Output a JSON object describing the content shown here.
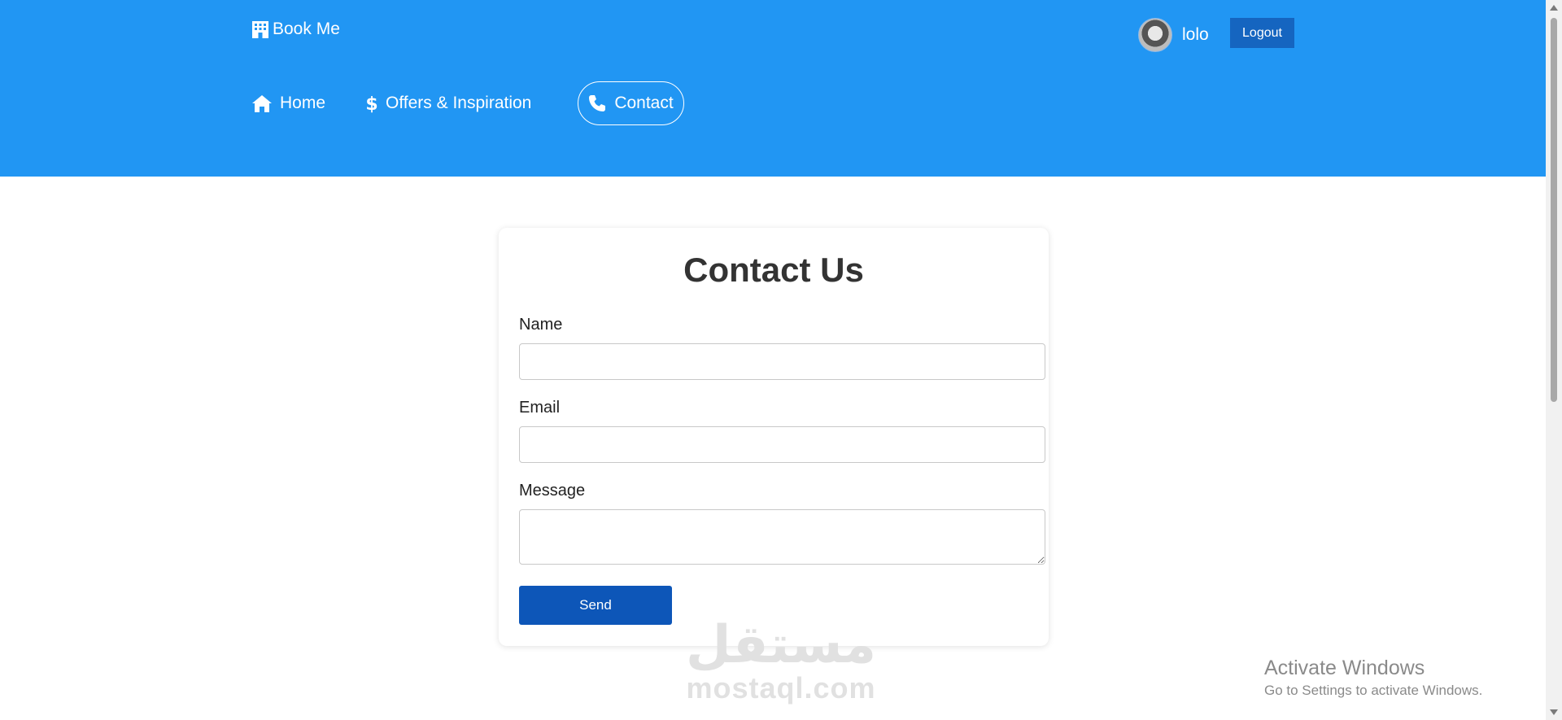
{
  "header": {
    "brand": "Book Me",
    "user": {
      "name": "lolo",
      "avatar_icon": "user-avatar"
    },
    "logout_label": "Logout",
    "background_color": "#2196f3"
  },
  "nav": {
    "items": [
      {
        "label": "Home",
        "icon": "home-icon"
      },
      {
        "label": "Offers & Inspiration",
        "icon": "dollar-icon"
      },
      {
        "label": "Contact",
        "icon": "phone-icon",
        "active": true
      }
    ]
  },
  "form": {
    "title": "Contact Us",
    "name_label": "Name",
    "name_value": "",
    "email_label": "Email",
    "email_value": "",
    "message_label": "Message",
    "message_value": "",
    "send_label": "Send",
    "send_color": "#0d56b8"
  },
  "watermark": {
    "arabic": "مستقل",
    "latin": "mostaql.com"
  },
  "os_notice": {
    "title": "Activate Windows",
    "subtitle": "Go to Settings to activate Windows."
  }
}
